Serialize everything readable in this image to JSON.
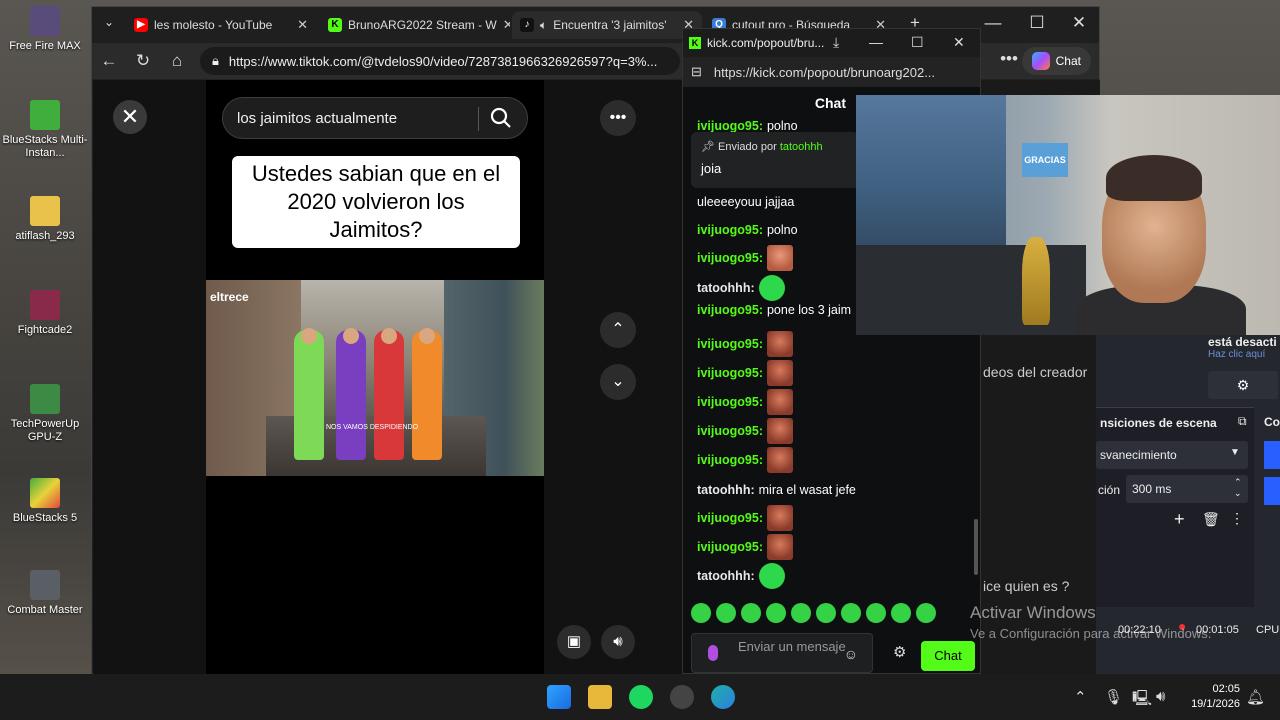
{
  "desktop": {
    "icons": [
      {
        "label": "Free Fire MAX",
        "color": "#5a4c7a"
      },
      {
        "label": "BlueStacks Multi-Instan...",
        "color": "#3fae3c"
      },
      {
        "label": "atiflash_293",
        "color": "#e8c24a"
      },
      {
        "label": "Fightcade2",
        "color": "#8a2a4a"
      },
      {
        "label": "TechPowerUp GPU-Z",
        "color": "#3d8a44"
      },
      {
        "label": "BlueStacks 5",
        "color": "#3fae3c"
      },
      {
        "label": "Combat Master",
        "color": "#5a5f66"
      }
    ]
  },
  "browser": {
    "tabs": [
      {
        "title": "les molesto - YouTube",
        "fav": "▶",
        "favcolor": "#ff0000"
      },
      {
        "title": "BrunoARG2022 Stream - W",
        "fav": "K",
        "favcolor": "#53fc18"
      },
      {
        "title": "Encuentra '3 jaimitos'",
        "fav": "♪",
        "favcolor": "#111111"
      },
      {
        "title": "cutout pro - Búsqueda",
        "fav": "Q",
        "favcolor": "#3a7bd5"
      }
    ],
    "new_tab": "+",
    "url": "https://www.tiktok.com/@tvdelos90/video/7287381966326926597?q=3%...",
    "more": "•••",
    "copilot_label": "Chat"
  },
  "tiktok": {
    "search_value": "los jaimitos actualmente",
    "caption": "Ustedes sabian que en el 2020 volvieron los Jaimitos?",
    "brand": "eltrece",
    "subtitle": "NOS VAMOS DESPIDIENDO",
    "close": "✕",
    "more": "•••",
    "up": "⌃",
    "down": "⌄",
    "creator_videos": "deos del creador",
    "question": "ice quien es ?"
  },
  "kick": {
    "window_title": "kick.com/popout/bru...",
    "url": "https://kick.com/popout/brunoarg202...",
    "chat_header": "Chat",
    "pinned_by_label": "Enviado por",
    "pinned_user": "tatoohhh",
    "pinned_text": "joia",
    "messages": [
      {
        "user": "ivijuogo95:",
        "text": "polno",
        "emote": ""
      },
      {
        "user": "",
        "text": "uleeeeyouu jajjaa",
        "emote": ""
      },
      {
        "user": "ivijuogo95:",
        "text": "polno",
        "emote": ""
      },
      {
        "user": "ivijuogo95:",
        "text": "",
        "emote": "face2"
      },
      {
        "user": "tatoohhh:",
        "text": "",
        "emote": "green"
      },
      {
        "user": "ivijuogo95:",
        "text": "pone los 3 jaim",
        "emote": ""
      },
      {
        "user": "ivijuogo95:",
        "text": "",
        "emote": "face"
      },
      {
        "user": "ivijuogo95:",
        "text": "",
        "emote": "face"
      },
      {
        "user": "ivijuogo95:",
        "text": "",
        "emote": "face"
      },
      {
        "user": "ivijuogo95:",
        "text": "",
        "emote": "face"
      },
      {
        "user": "ivijuogo95:",
        "text": "",
        "emote": "face"
      },
      {
        "user": "tatoohhh:",
        "text": "mira el wasat jefe",
        "emote": ""
      },
      {
        "user": "ivijuogo95:",
        "text": "",
        "emote": "face"
      },
      {
        "user": "ivijuogo95:",
        "text": "",
        "emote": "face"
      },
      {
        "user": "tatoohhh:",
        "text": "",
        "emote": "green"
      }
    ],
    "input_placeholder": "Enviar un mensaje",
    "send_label": "Chat"
  },
  "cam": {
    "sign_text": "GRACIAS"
  },
  "obs": {
    "status": "está desacti",
    "status2": "Haz clic aquí",
    "transitions_title": "nsiciones de escena",
    "transition_value": "svanecimiento",
    "duration_label": "ción",
    "duration_value": "300 ms",
    "corner_label": "Co",
    "time1": "00:22:10",
    "time2": "00:01:05",
    "cpu": "CPU"
  },
  "watermark": {
    "line1": "Activar Windows",
    "line2": "Ve a Configuración para activar Windows."
  },
  "taskbar": {
    "time": "02:05",
    "date": "19/1/2026"
  }
}
